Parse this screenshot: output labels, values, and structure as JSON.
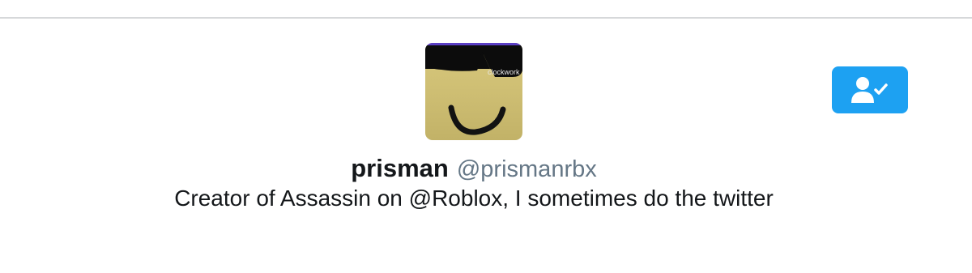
{
  "profile": {
    "display_name": "prisman",
    "handle": "@prismanrbx",
    "bio": "Creator of Assassin on @Roblox, I sometimes do the twitter",
    "avatar_text": "clockwork"
  },
  "follow_button": {
    "icon": "user-check-icon",
    "state": "following",
    "color": "#1da1f2"
  },
  "colors": {
    "name": "#14171a",
    "handle": "#657786",
    "divider": "#d6d8da"
  }
}
